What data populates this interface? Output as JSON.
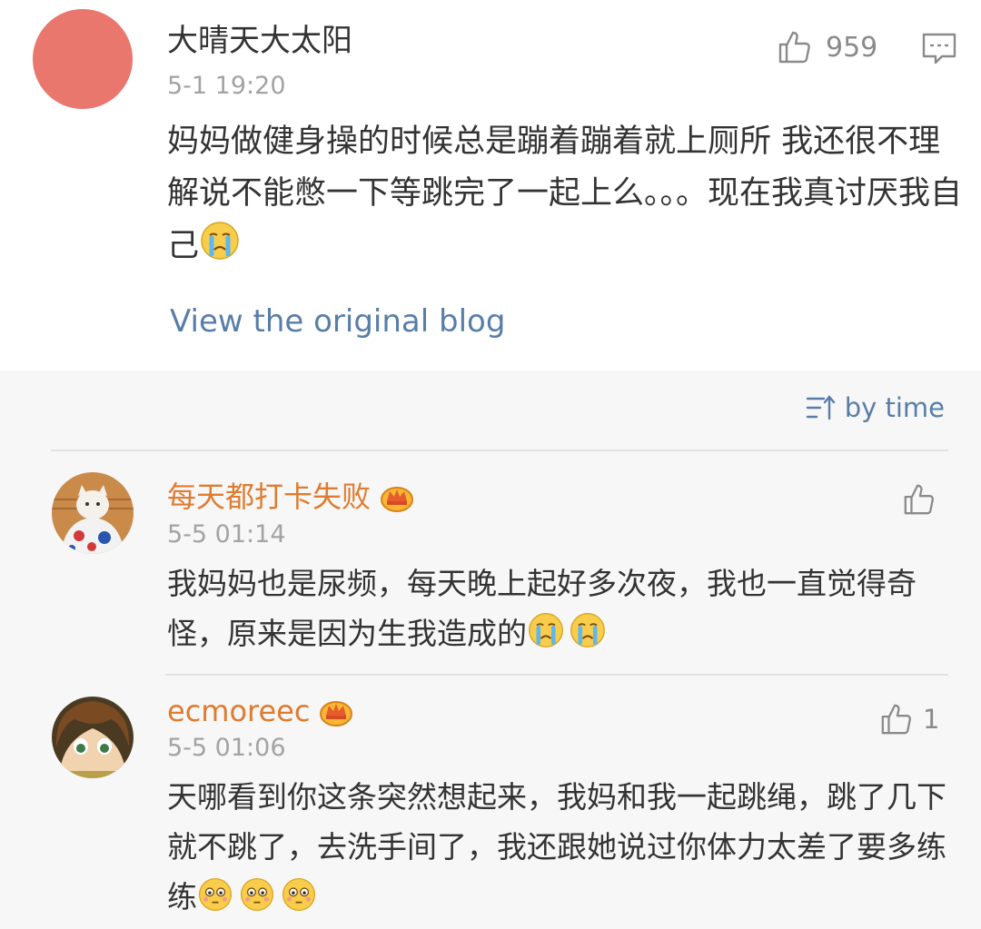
{
  "main_post": {
    "username": "大晴天大太阳",
    "time": "5-1 19:20",
    "likes": "959",
    "text": "妈妈做健身操的时候总是蹦着蹦着就上厕所 我还很不理解说不能憋一下等跳完了一起上么。。。现在我真讨厌我自己",
    "emoji": "cry-icon",
    "view_original": "View the original blog"
  },
  "sort": {
    "label": "by time",
    "icon": "sort-icon"
  },
  "comments": [
    {
      "username": "每天都打卡失败",
      "time": "5-5 01:14",
      "likes": "",
      "text": "我妈妈也是尿频，每天晚上起好多次夜，我也一直觉得奇怪，原来是因为生我造成的",
      "emojis": [
        "cry-icon",
        "cry-icon"
      ]
    },
    {
      "username": "ecmoreec",
      "time": "5-5 01:06",
      "likes": "1",
      "text": "天哪看到你这条突然想起来，我妈和我一起跳绳，跳了几下就不跳了，去洗手间了，我还跟她说过你体力太差了要多练练",
      "emojis": [
        "flushed-icon",
        "flushed-icon",
        "flushed-icon"
      ]
    }
  ],
  "colors": {
    "link": "#587ea8",
    "username_vip": "#e07b2f",
    "avatar_main": "#e9776d"
  }
}
